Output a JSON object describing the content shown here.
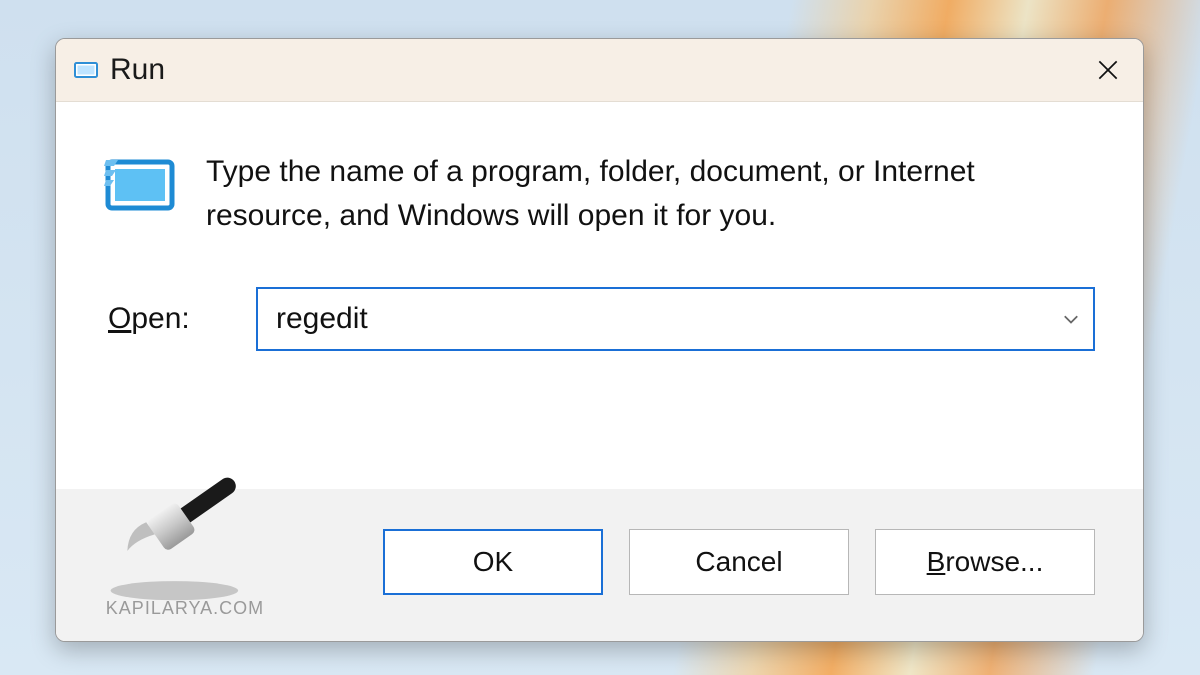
{
  "dialog": {
    "title": "Run",
    "instruction": "Type the name of a program, folder, document, or Internet resource, and Windows will open it for you.",
    "open_label_pre": "O",
    "open_label_rest": "pen:",
    "input_value": "regedit",
    "buttons": {
      "ok": "OK",
      "cancel": "Cancel",
      "browse_pre": "B",
      "browse_rest": "rowse..."
    }
  },
  "watermark": "KAPILARYA.COM"
}
